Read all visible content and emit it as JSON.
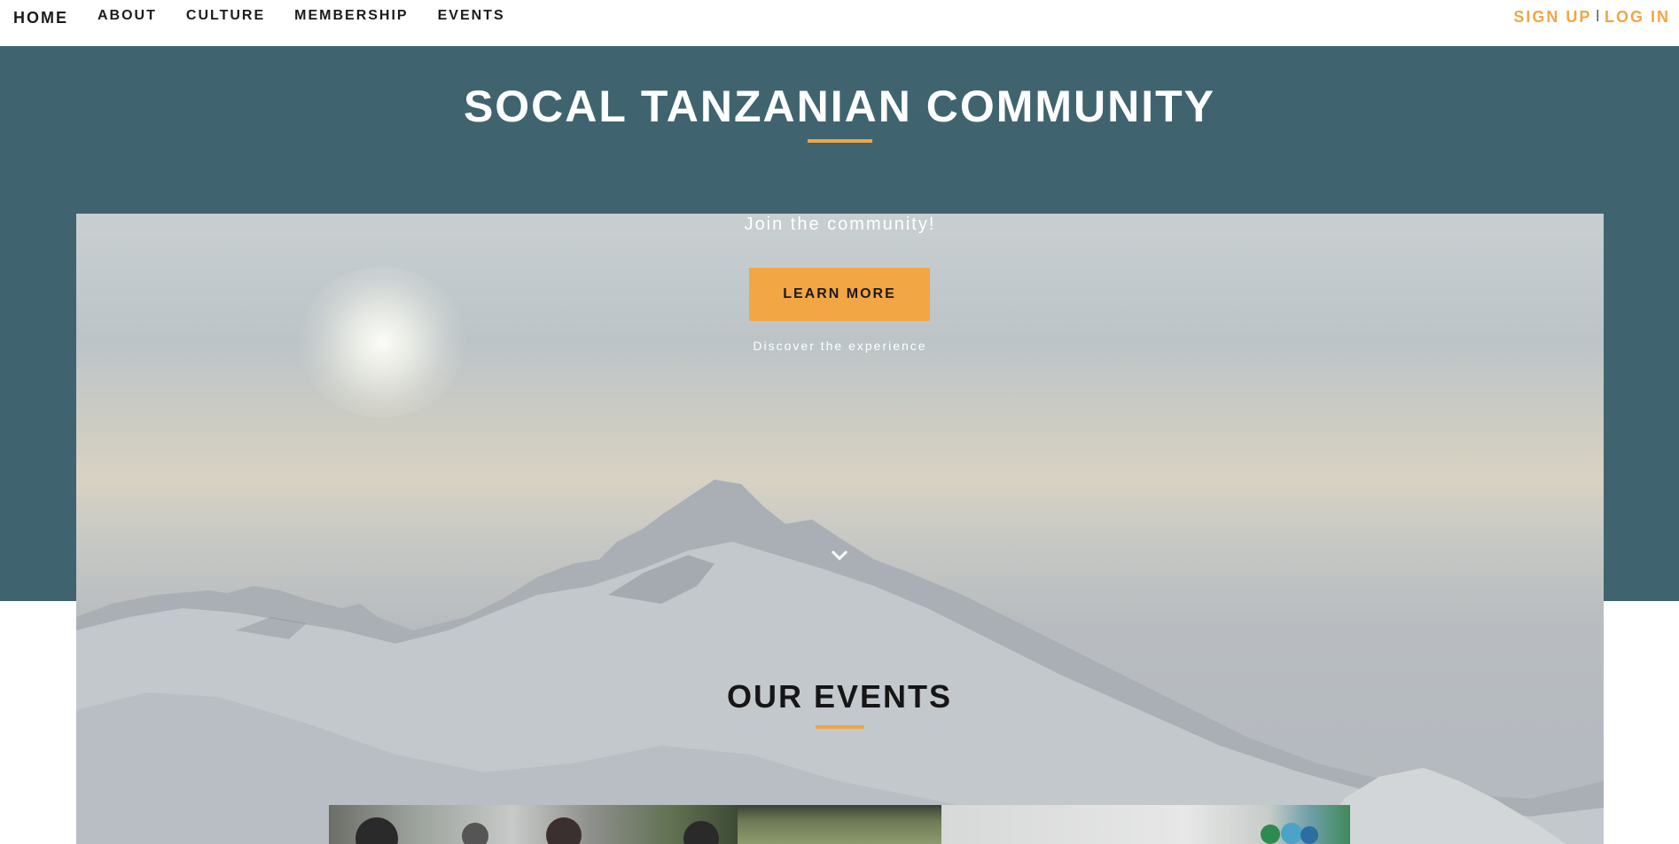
{
  "nav": {
    "items": [
      {
        "label": "HOME"
      },
      {
        "label": "ABOUT"
      },
      {
        "label": "CULTURE"
      },
      {
        "label": "MEMBERSHIP"
      },
      {
        "label": "EVENTS"
      }
    ],
    "signup_label": "SIGN UP",
    "separator": "|",
    "login_label": "LOG IN"
  },
  "header": {
    "title": "SOCAL TANZANIAN COMMUNITY"
  },
  "hero": {
    "subtitle": "Join the community!",
    "button_label": "LEARN MORE",
    "caption": "Discover the experience",
    "scroll_icon": "chevron-down-icon"
  },
  "events": {
    "title": "OUR EVENTS"
  },
  "colors": {
    "accent": "#f2a644",
    "band": "#40646f",
    "text_dark": "#1b1b1b"
  }
}
